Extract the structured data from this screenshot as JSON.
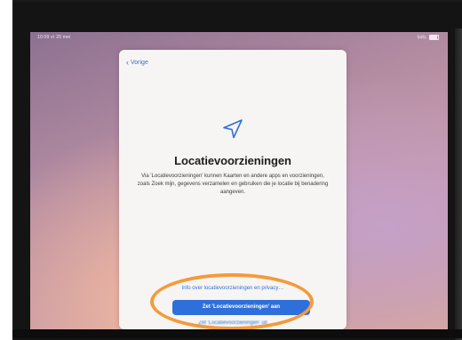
{
  "status_bar": {
    "time_date": "10:09  vr 20 mei",
    "battery": "94%"
  },
  "setup": {
    "back_label": "Vorige",
    "title": "Locatievoorzieningen",
    "description": "Via 'Locatievoorzieningen' kunnen Kaarten en andere apps en voorzieningen, zoals Zoek mijn, gegevens verzamelen en gebruiken die je locatie bij benadering aangeven.",
    "info_link": "Info over locatievoorzieningen en privacy…",
    "enable_button": "Zet 'Locatievoorzieningen' aan",
    "disable_link": "Zet 'Locatievoorzieningen' uit"
  },
  "icons": {
    "back": "chevron-left-icon",
    "location": "location-arrow-icon",
    "battery": "battery-icon"
  },
  "colors": {
    "accent": "#2f6fdb",
    "annotation": "#f49a3c"
  }
}
